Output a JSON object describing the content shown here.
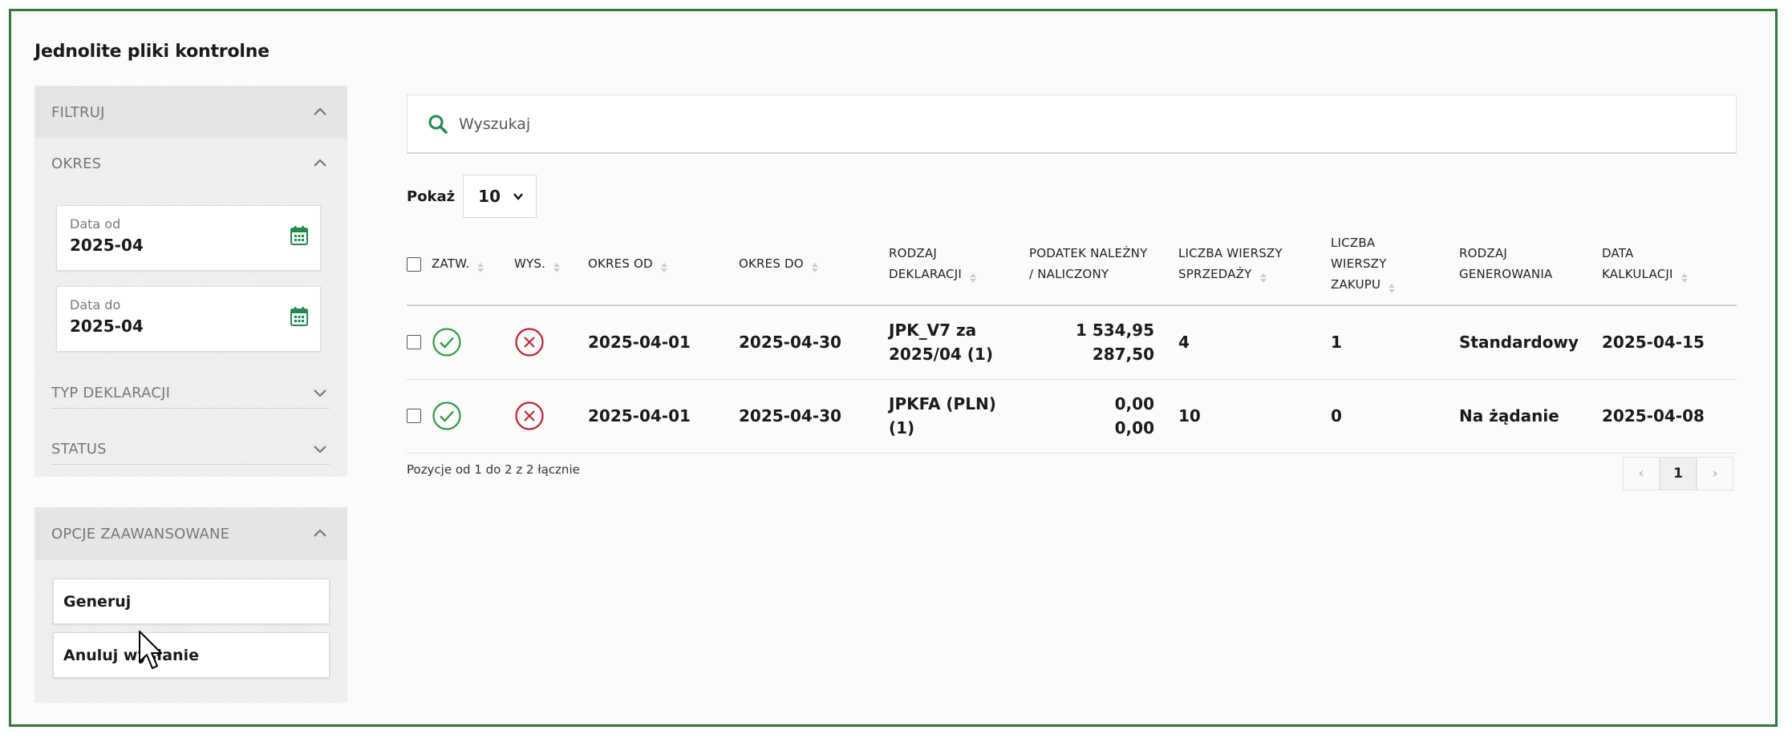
{
  "page": {
    "title": "Jednolite pliki kontrolne"
  },
  "sidebar": {
    "filter_title": "FILTRUJ",
    "period": {
      "title": "OKRES",
      "date_from": {
        "label": "Data od",
        "value": "2025-04"
      },
      "date_to": {
        "label": "Data do",
        "value": "2025-04"
      }
    },
    "declaration_type_title": "TYP DEKLARACJI",
    "status_title": "STATUS"
  },
  "advanced": {
    "title": "OPCJE ZAAWANSOWANE",
    "generate_label": "Generuj",
    "cancel_label": "Anuluj wysłanie"
  },
  "search": {
    "placeholder": "Wyszukaj"
  },
  "page_size": {
    "label": "Pokaż",
    "value": "10"
  },
  "table": {
    "headers": {
      "approved": "ZATW.",
      "sent": "WYS.",
      "period_from": "OKRES OD",
      "period_to": "OKRES DO",
      "decl_type_1": "RODZAJ",
      "decl_type_2": "DEKLARACJI",
      "tax_1": "PODATEK NALEŻNY",
      "tax_2": "/ NALICZONY",
      "sales_1": "LICZBA WIERSZY",
      "sales_2": "SPRZEDAŻY",
      "purchase_1": "LICZBA",
      "purchase_2": "WIERSZY",
      "purchase_3": "ZAKUPU",
      "gen_type_1": "RODZAJ",
      "gen_type_2": "GENEROWANIA",
      "calc_date_1": "DATA",
      "calc_date_2": "KALKULACJI"
    },
    "rows": [
      {
        "period_from": "2025-04-01",
        "period_to": "2025-04-30",
        "decl_1": "JPK_V7 za",
        "decl_2": "2025/04 (1)",
        "tax_due": "1 534,95",
        "tax_input": "287,50",
        "sales_rows": "4",
        "purchase_rows": "1",
        "gen_type": "Standardowy",
        "calc_date": "2025-04-15"
      },
      {
        "period_from": "2025-04-01",
        "period_to": "2025-04-30",
        "decl_1": "JPKFA (PLN)",
        "decl_2": "(1)",
        "tax_due": "0,00",
        "tax_input": "0,00",
        "sales_rows": "10",
        "purchase_rows": "0",
        "gen_type": "Na żądanie",
        "calc_date": "2025-04-08"
      }
    ]
  },
  "summary": "Pozycje od 1 do 2 z 2 łącznie",
  "pagination": {
    "prev": "‹",
    "current": "1",
    "next": "›"
  },
  "colors": {
    "accent": "#2d7a3a",
    "ok": "#2e9e3e",
    "error": "#c8202f",
    "calendar": "#1f8a4c"
  }
}
